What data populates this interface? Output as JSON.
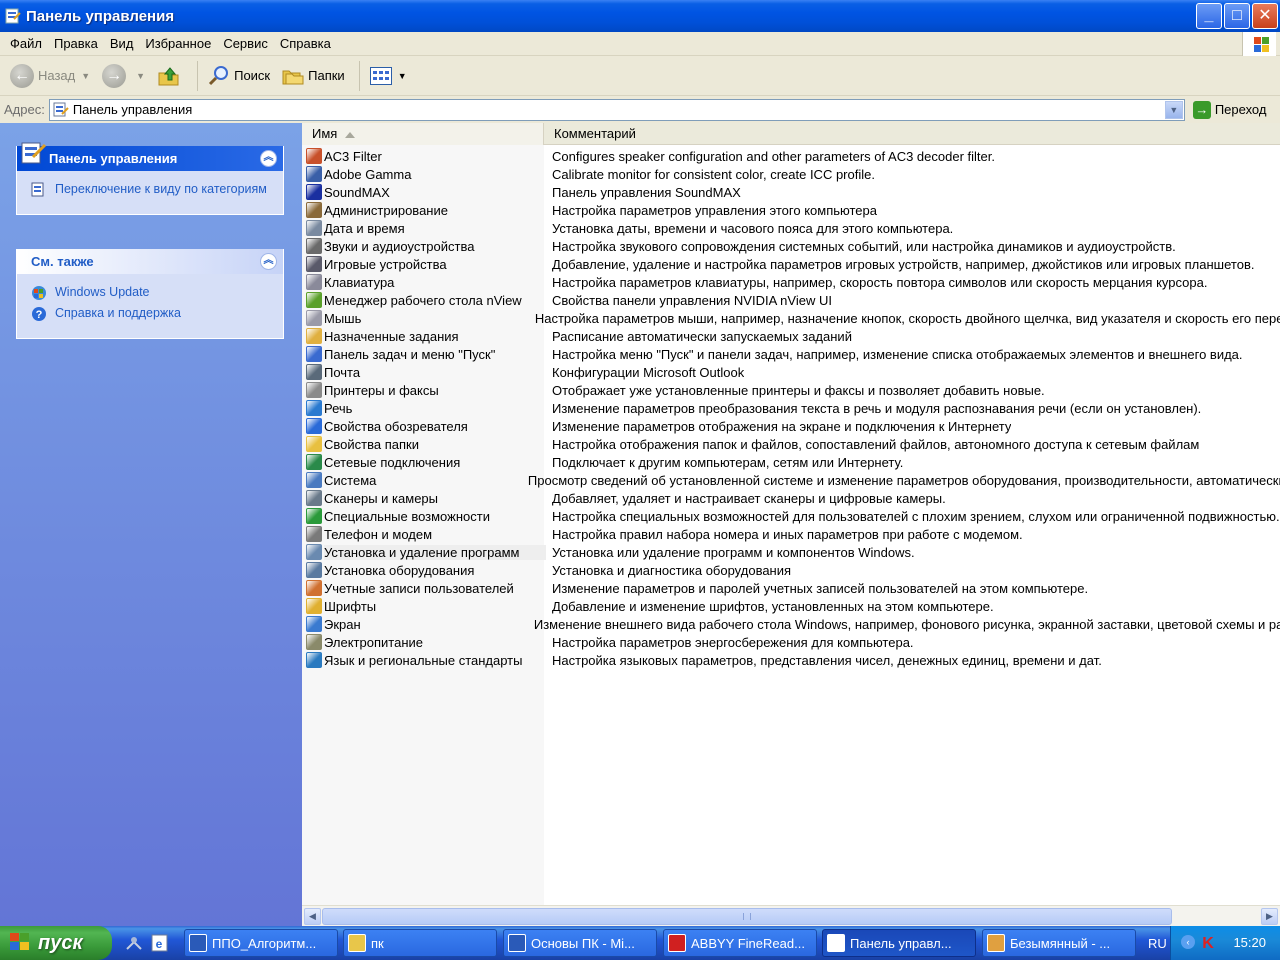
{
  "window": {
    "title": "Панель управления"
  },
  "menu": [
    "Файл",
    "Правка",
    "Вид",
    "Избранное",
    "Сервис",
    "Справка"
  ],
  "toolbar": {
    "back_label": "Назад",
    "search_label": "Поиск",
    "folders_label": "Папки"
  },
  "address": {
    "label": "Адрес:",
    "value": "Панель управления",
    "go_label": "Переход"
  },
  "sidebar": {
    "panel1": {
      "title": "Панель управления",
      "link": "Переключение к виду по категориям"
    },
    "panel2": {
      "title": "См. также",
      "links": [
        "Windows Update",
        "Справка и поддержка"
      ]
    }
  },
  "list": {
    "columns": {
      "name": "Имя",
      "comment": "Комментарий"
    },
    "rows": [
      {
        "name": "AC3 Filter",
        "comment": "Configures speaker configuration and other parameters of AC3 decoder filter.",
        "icon": "ac3-icon",
        "color": "#c8502a"
      },
      {
        "name": "Adobe Gamma",
        "comment": "Calibrate monitor for consistent color, create ICC profile.",
        "icon": "monitor-icon",
        "color": "#3a5fa8"
      },
      {
        "name": "SoundMAX",
        "comment": "Панель управления SoundMAX",
        "icon": "soundmax-icon",
        "color": "#1a2fa0"
      },
      {
        "name": "Администрирование",
        "comment": "Настройка параметров управления этого компьютера",
        "icon": "admin-tools-icon",
        "color": "#8a6a3a"
      },
      {
        "name": "Дата и время",
        "comment": "Установка даты, времени и часового пояса для этого компьютера.",
        "icon": "clock-icon",
        "color": "#7a8aa0"
      },
      {
        "name": "Звуки и аудиоустройства",
        "comment": "Настройка звукового сопровождения системных событий, или настройка динамиков и аудиоустройств.",
        "icon": "speaker-icon",
        "color": "#6a6a6a"
      },
      {
        "name": "Игровые устройства",
        "comment": "Добавление, удаление и настройка параметров игровых устройств, например, джойстиков или игровых планшетов.",
        "icon": "joystick-icon",
        "color": "#5a5a6a"
      },
      {
        "name": "Клавиатура",
        "comment": "Настройка параметров клавиатуры, например, скорость повтора символов или скорость мерцания курсора.",
        "icon": "keyboard-icon",
        "color": "#8a8a9a"
      },
      {
        "name": "Менеджер рабочего стола nView",
        "comment": "Свойства панели управления NVIDIA nView UI",
        "icon": "nvidia-icon",
        "color": "#5aa02a"
      },
      {
        "name": "Мышь",
        "comment": "Настройка параметров мыши, например, назначение кнопок, скорость двойного щелчка, вид указателя и скорость его перемещения.",
        "icon": "mouse-icon",
        "color": "#9a9aa8"
      },
      {
        "name": "Назначенные задания",
        "comment": "Расписание автоматически запускаемых заданий",
        "icon": "scheduled-tasks-icon",
        "color": "#e0b040"
      },
      {
        "name": "Панель задач и меню \"Пуск\"",
        "comment": "Настройка меню \"Пуск\" и панели задач, например, изменение списка отображаемых элементов и внешнего вида.",
        "icon": "taskbar-icon",
        "color": "#3a6ad0"
      },
      {
        "name": "Почта",
        "comment": "Конфигурации Microsoft Outlook",
        "icon": "mail-icon",
        "color": "#5a6a7a"
      },
      {
        "name": "Принтеры и факсы",
        "comment": "Отображает уже установленные принтеры и факсы и позволяет добавить новые.",
        "icon": "printer-icon",
        "color": "#8a8a8a"
      },
      {
        "name": "Речь",
        "comment": "Изменение параметров преобразования текста в речь и модуля распознавания речи (если он установлен).",
        "icon": "speech-icon",
        "color": "#2a7ad0"
      },
      {
        "name": "Свойства обозревателя",
        "comment": "Изменение параметров отображения на экране и подключения к Интернету",
        "icon": "internet-options-icon",
        "color": "#2a6ad8"
      },
      {
        "name": "Свойства папки",
        "comment": "Настройка отображения папок и файлов, сопоставлений файлов, автономного доступа к сетевым файлам",
        "icon": "folder-options-icon",
        "color": "#e8c040"
      },
      {
        "name": "Сетевые подключения",
        "comment": "Подключает к другим компьютерам, сетям или Интернету.",
        "icon": "network-icon",
        "color": "#2a8a4a"
      },
      {
        "name": "Система",
        "comment": "Просмотр сведений об установленной системе и изменение параметров оборудования, производительности, автоматических обновлений.",
        "icon": "system-icon",
        "color": "#4a7ac0"
      },
      {
        "name": "Сканеры и камеры",
        "comment": "Добавляет, удаляет и настраивает сканеры и цифровые камеры.",
        "icon": "scanner-icon",
        "color": "#6a7a8a"
      },
      {
        "name": "Специальные возможности",
        "comment": "Настройка специальных возможностей для пользователей с плохим зрением, слухом или ограниченной подвижностью.",
        "icon": "accessibility-icon",
        "color": "#2a9a3a"
      },
      {
        "name": "Телефон и модем",
        "comment": "Настройка правил набора номера и иных параметров при работе с модемом.",
        "icon": "phone-icon",
        "color": "#7a7a7a"
      },
      {
        "name": "Установка и удаление программ",
        "comment": "Установка или удаление программ и компонентов Windows.",
        "icon": "add-remove-programs-icon",
        "color": "#6a8ab0"
      },
      {
        "name": "Установка оборудования",
        "comment": "Установка и диагностика оборудования",
        "icon": "add-hardware-icon",
        "color": "#5a7aa0"
      },
      {
        "name": "Учетные записи пользователей",
        "comment": "Изменение параметров и паролей учетных записей пользователей на этом компьютере.",
        "icon": "users-icon",
        "color": "#d07030"
      },
      {
        "name": "Шрифты",
        "comment": "Добавление и изменение шрифтов, установленных на этом компьютере.",
        "icon": "fonts-icon",
        "color": "#e0b030"
      },
      {
        "name": "Экран",
        "comment": "Изменение внешнего вида рабочего стола Windows, например, фонового рисунка, экранной заставки, цветовой схемы и разрешения.",
        "icon": "display-icon",
        "color": "#3a7ad0"
      },
      {
        "name": "Электропитание",
        "comment": "Настройка параметров энергосбережения для компьютера.",
        "icon": "power-icon",
        "color": "#8a8a6a"
      },
      {
        "name": "Язык и региональные стандарты",
        "comment": "Настройка языковых параметров, представления чисел, денежных единиц, времени и дат.",
        "icon": "globe-icon",
        "color": "#2a7ac0"
      }
    ]
  },
  "taskbar": {
    "start_label": "пуск",
    "tasks": [
      {
        "label": "ППО_Алгоритм...",
        "icon": "word-icon"
      },
      {
        "label": "пк",
        "icon": "folder-icon"
      },
      {
        "label": "Основы ПК - Mi...",
        "icon": "word-icon"
      },
      {
        "label": "ABBYY FineRead...",
        "icon": "abbyy-icon"
      },
      {
        "label": "Панель управл...",
        "icon": "control-panel-icon"
      },
      {
        "label": "Безымянный - ...",
        "icon": "paint-icon"
      }
    ],
    "language": "RU",
    "clock": "15:20"
  }
}
